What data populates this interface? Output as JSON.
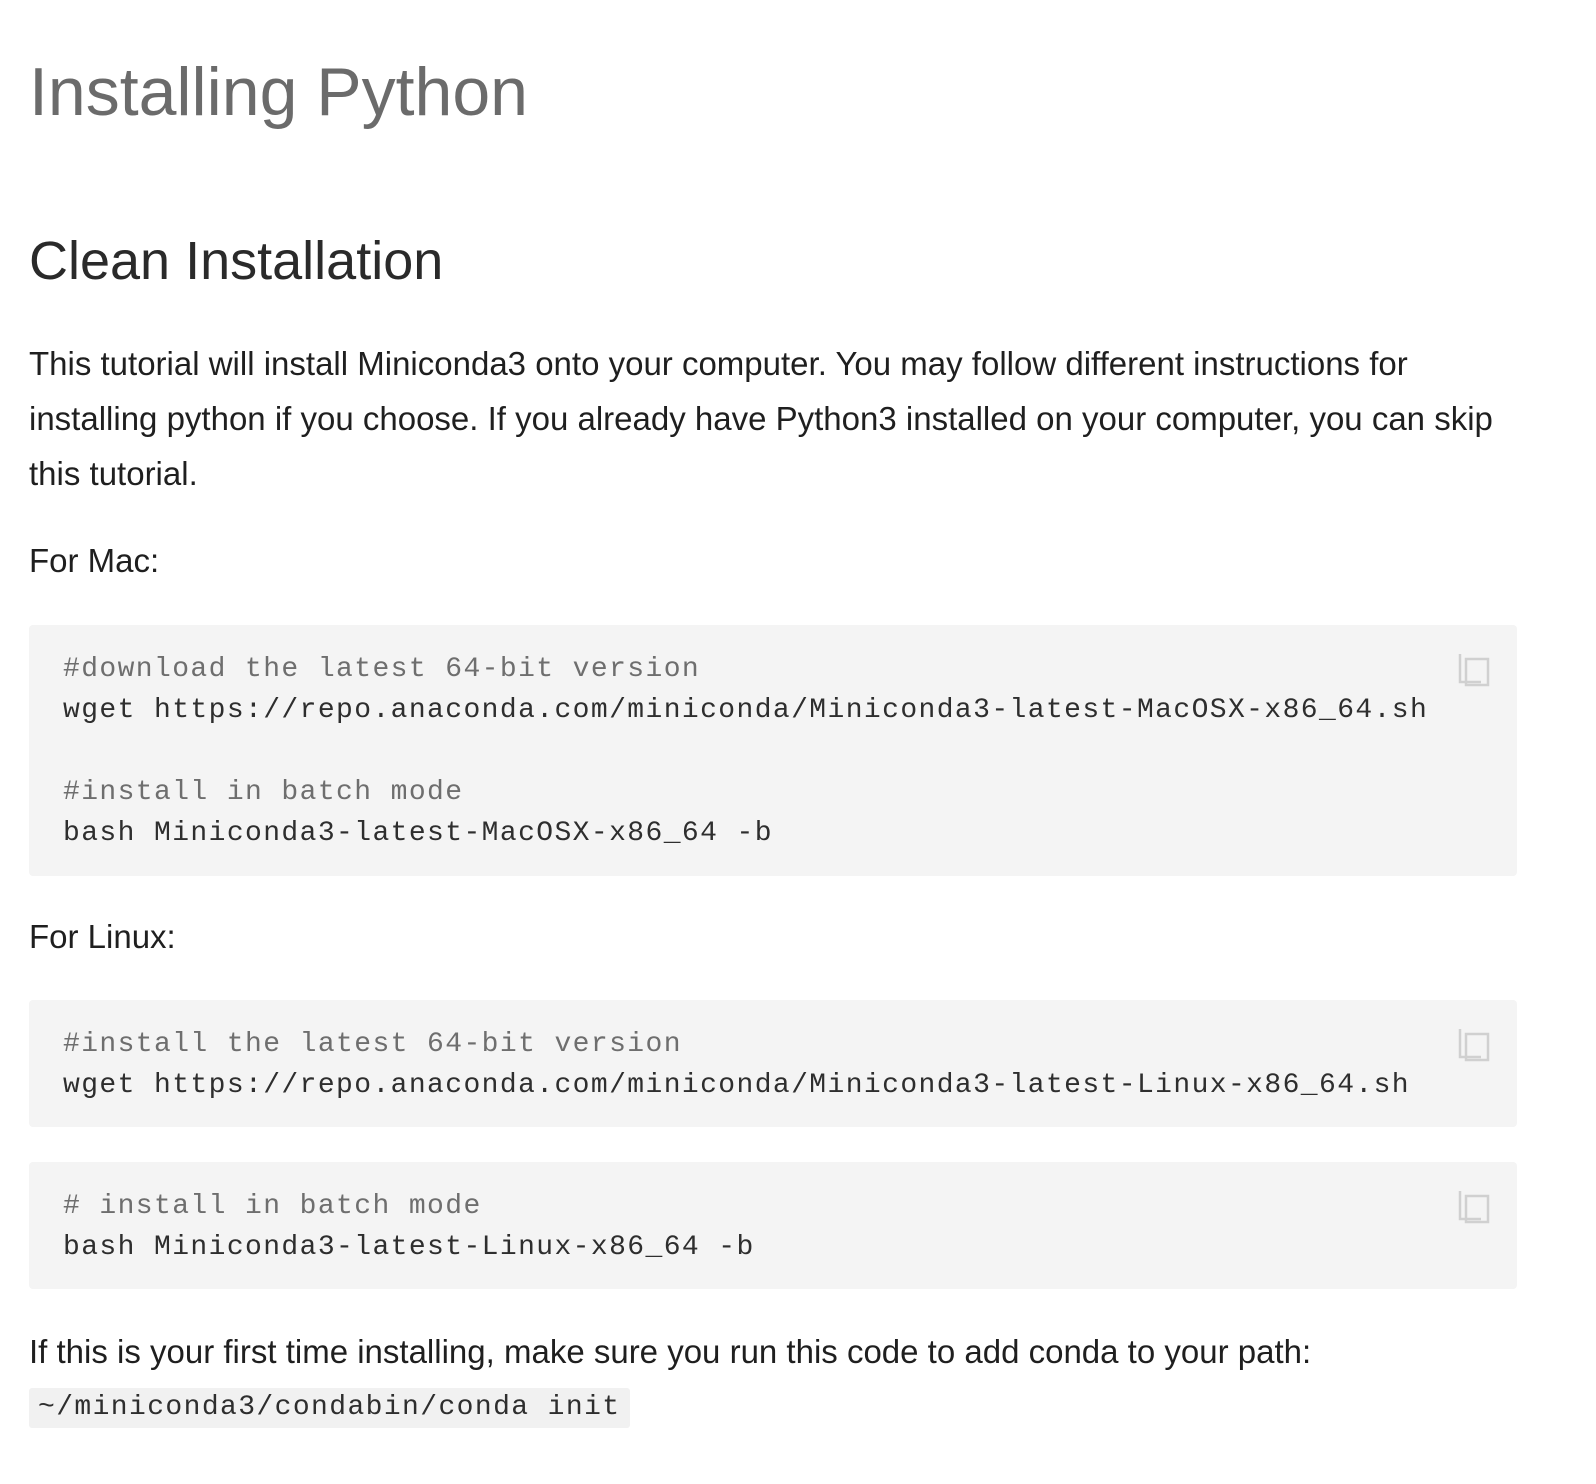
{
  "page": {
    "title": "Installing Python",
    "section_title": "Clean Installation",
    "intro": "This tutorial will install Miniconda3 onto your computer. You may follow different instructions for installing python if you choose. If you already have Python3 installed on your computer, you can skip this tutorial."
  },
  "mac": {
    "label": "For Mac:",
    "code": {
      "comment1": "#download the latest 64-bit version",
      "line1": "wget https://repo.anaconda.com/miniconda/Miniconda3-latest-MacOSX-x86_64.sh",
      "comment2": "#install in batch mode",
      "line2": "bash Miniconda3-latest-MacOSX-x86_64 -b"
    }
  },
  "linux": {
    "label": "For Linux:",
    "code1": {
      "comment": "#install the latest 64-bit version",
      "line": "wget https://repo.anaconda.com/miniconda/Miniconda3-latest-Linux-x86_64.sh"
    },
    "code2": {
      "comment": "# install in batch mode",
      "line": "bash Miniconda3-latest-Linux-x86_64 -b"
    }
  },
  "footer": {
    "text": "If this is your first time installing, make sure you run this code to add conda to your path:",
    "inline_code": "~/miniconda3/condabin/conda init"
  },
  "icons": {
    "copy": "copy-icon"
  },
  "colors": {
    "code_background": "#f4f4f4",
    "title": "#6b6b6b",
    "comment": "#6e6e6e",
    "icon": "#d0d0d0"
  }
}
